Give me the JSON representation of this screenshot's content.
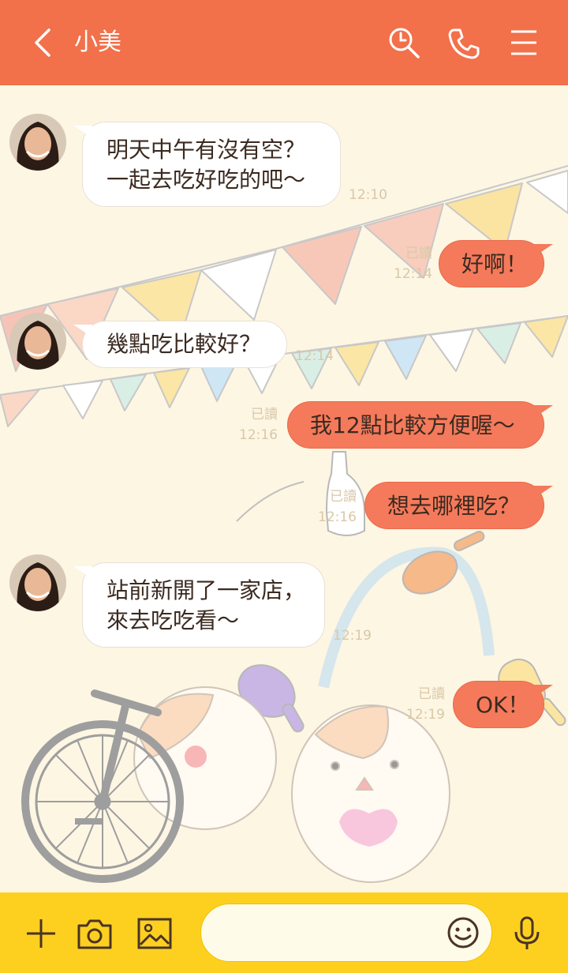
{
  "header": {
    "title": "小美",
    "icons": [
      "back-arrow-icon",
      "search-icon",
      "phone-icon",
      "menu-icon"
    ]
  },
  "messages": [
    {
      "side": "incoming",
      "lines": [
        "明天中午有沒有空？",
        "一起去吃好吃的吧～"
      ],
      "time": "12:10"
    },
    {
      "side": "outgoing",
      "text": "好啊！",
      "read": "已讀",
      "time": "12:14"
    },
    {
      "side": "incoming",
      "lines": [
        "幾點吃比較好？"
      ],
      "time": "12:14"
    },
    {
      "side": "outgoing",
      "text": "我12點比較方便喔～",
      "read": "已讀",
      "time": "12:16"
    },
    {
      "side": "outgoing",
      "text": "想去哪裡吃？",
      "read": "已讀",
      "time": "12:16"
    },
    {
      "side": "incoming",
      "lines": [
        "站前新開了一家店，",
        "來去吃吃看～"
      ],
      "time": "12:19"
    },
    {
      "side": "outgoing",
      "text": "OK！",
      "read": "已讀",
      "time": "12:19"
    }
  ],
  "footer": {
    "icons": [
      "plus-icon",
      "camera-icon",
      "image-icon",
      "emoji-icon",
      "microphone-icon"
    ],
    "input_value": ""
  },
  "colors": {
    "header": "#f2704a",
    "footer": "#fdd020",
    "outgoing_bubble": "#f47a5b",
    "background": "#fdf6e3"
  }
}
